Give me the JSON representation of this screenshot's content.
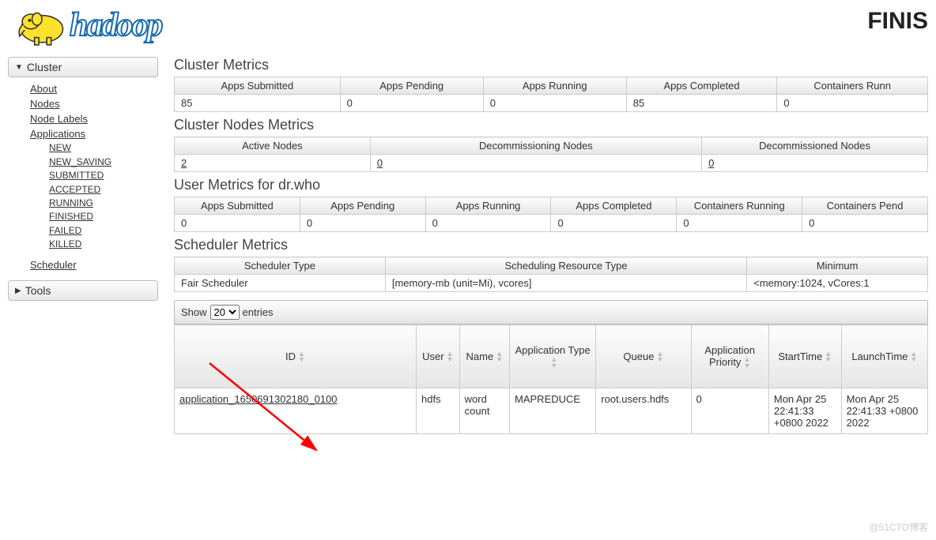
{
  "header": {
    "page_title": "FINIS"
  },
  "sidebar": {
    "cluster_label": "Cluster",
    "tools_label": "Tools",
    "links": {
      "about": "About",
      "nodes": "Nodes",
      "node_labels": "Node Labels",
      "applications": "Applications",
      "scheduler": "Scheduler"
    },
    "app_states": [
      "NEW",
      "NEW_SAVING",
      "SUBMITTED",
      "ACCEPTED",
      "RUNNING",
      "FINISHED",
      "FAILED",
      "KILLED"
    ]
  },
  "cluster_metrics": {
    "title": "Cluster Metrics",
    "headers": [
      "Apps Submitted",
      "Apps Pending",
      "Apps Running",
      "Apps Completed",
      "Containers Runn"
    ],
    "row": [
      "85",
      "0",
      "0",
      "85",
      "0"
    ]
  },
  "cluster_nodes": {
    "title": "Cluster Nodes Metrics",
    "headers": [
      "Active Nodes",
      "Decommissioning Nodes",
      "Decommissioned Nodes"
    ],
    "row": [
      "2",
      "0",
      "0"
    ]
  },
  "user_metrics": {
    "title": "User Metrics for dr.who",
    "headers": [
      "Apps Submitted",
      "Apps Pending",
      "Apps Running",
      "Apps Completed",
      "Containers Running",
      "Containers Pend"
    ],
    "row": [
      "0",
      "0",
      "0",
      "0",
      "0",
      "0"
    ]
  },
  "scheduler_metrics": {
    "title": "Scheduler Metrics",
    "headers": [
      "Scheduler Type",
      "Scheduling Resource Type",
      "Minimum"
    ],
    "row": [
      "Fair Scheduler",
      "[memory-mb (unit=Mi), vcores]",
      "<memory:1024, vCores:1"
    ]
  },
  "apps_table": {
    "show_label": "Show",
    "entries_label": "entries",
    "page_size": "20",
    "headers": [
      "ID",
      "User",
      "Name",
      "Application Type",
      "Queue",
      "Application Priority",
      "StartTime",
      "LaunchTime"
    ],
    "row": {
      "id": "application_1650691302180_0100",
      "user": "hdfs",
      "name": "word count",
      "type": "MAPREDUCE",
      "queue": "root.users.hdfs",
      "priority": "0",
      "start": "Mon Apr 25 22:41:33 +0800 2022",
      "launch": "Mon Apr 25 22:41:33 +0800 2022"
    }
  },
  "watermark": "@51CTO博客"
}
